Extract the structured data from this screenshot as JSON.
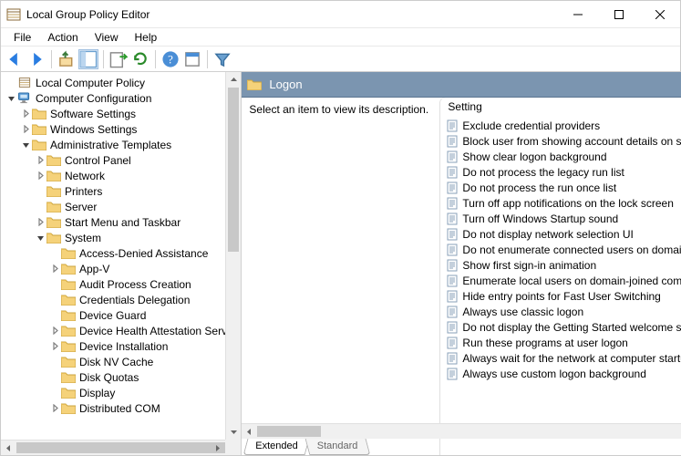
{
  "window": {
    "title": "Local Group Policy Editor"
  },
  "menu": {
    "items": [
      "File",
      "Action",
      "View",
      "Help"
    ]
  },
  "tree": {
    "root": "Local Computer Policy",
    "computer_configuration": "Computer Configuration",
    "software_settings": "Software Settings",
    "windows_settings": "Windows Settings",
    "admin_templates": "Administrative Templates",
    "control_panel": "Control Panel",
    "network": "Network",
    "printers": "Printers",
    "server": "Server",
    "start_menu": "Start Menu and Taskbar",
    "system": "System",
    "system_children": [
      "Access-Denied Assistance",
      "App-V",
      "Audit Process Creation",
      "Credentials Delegation",
      "Device Guard",
      "Device Health Attestation Service",
      "Device Installation",
      "Disk NV Cache",
      "Disk Quotas",
      "Display",
      "Distributed COM"
    ]
  },
  "right": {
    "title": "Logon",
    "description": "Select an item to view its description.",
    "column": "Setting",
    "settings": [
      "Exclude credential providers",
      "Block user from showing account details on sign-in",
      "Show clear logon background",
      "Do not process the legacy run list",
      "Do not process the run once list",
      "Turn off app notifications on the lock screen",
      "Turn off Windows Startup sound",
      "Do not display network selection UI",
      "Do not enumerate connected users on domain-joined computers",
      "Show first sign-in animation",
      "Enumerate local users on domain-joined computers",
      "Hide entry points for Fast User Switching",
      "Always use classic logon",
      "Do not display the Getting Started welcome screen at logon",
      "Run these programs at user logon",
      "Always wait for the network at computer startup and logon",
      "Always use custom logon background"
    ],
    "tabs": {
      "extended": "Extended",
      "standard": "Standard"
    }
  }
}
